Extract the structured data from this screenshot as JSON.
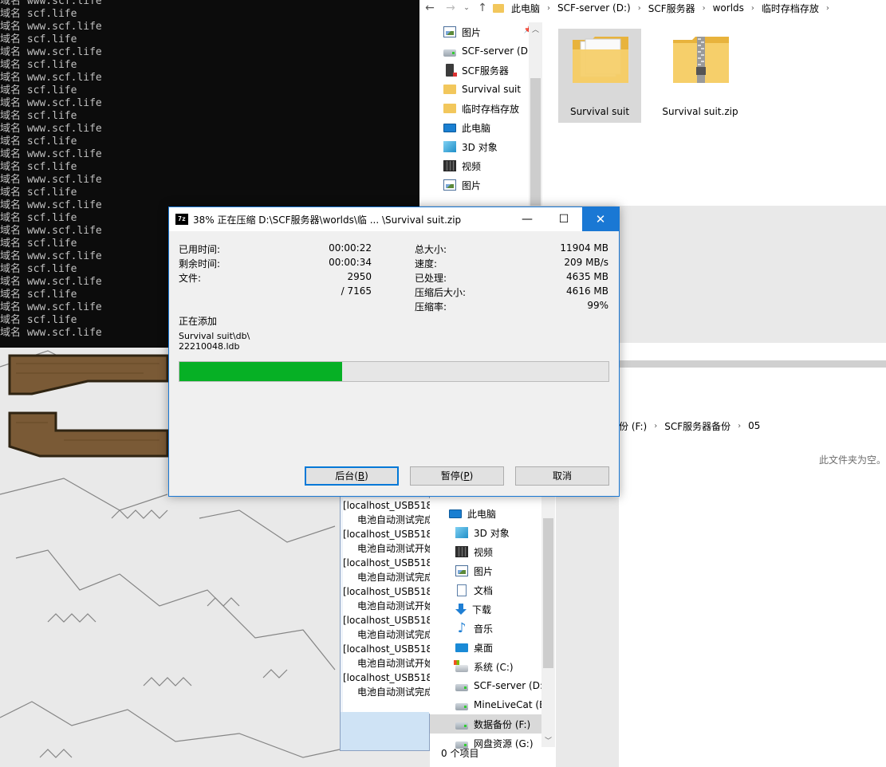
{
  "console": {
    "lines": [
      "域名 www.scf.life",
      "域名 scf.life",
      "域名 www.scf.life",
      "域名 scf.life",
      "域名 www.scf.life",
      "域名 scf.life",
      "域名 www.scf.life",
      "域名 scf.life",
      "域名 www.scf.life",
      "域名 scf.life",
      "域名 www.scf.life",
      "域名 scf.life",
      "域名 www.scf.life",
      "域名 scf.life",
      "域名 www.scf.life",
      "域名 scf.life",
      "域名 www.scf.life",
      "域名 scf.life",
      "域名 www.scf.life",
      "域名 scf.life",
      "域名 www.scf.life",
      "域名 scf.life",
      "域名 www.scf.life",
      "域名 scf.life",
      "域名 www.scf.life",
      "域名 scf.life",
      "域名 www.scf.life"
    ]
  },
  "explorer_top": {
    "breadcrumb": [
      "此电脑",
      "SCF-server (D:)",
      "SCF服务器",
      "worlds",
      "临时存档存放"
    ],
    "nav_items": [
      {
        "label": "图片",
        "icon": "pictures-icon",
        "pinned": true
      },
      {
        "label": "SCF-server (D:)",
        "icon": "drive-icon"
      },
      {
        "label": "SCF服务器",
        "icon": "server-icon"
      },
      {
        "label": "Survival suit",
        "icon": "folder-icon"
      },
      {
        "label": "临时存档存放",
        "icon": "folder-icon"
      },
      {
        "label": "此电脑",
        "icon": "computer-icon"
      },
      {
        "label": "3D 对象",
        "icon": "3d-objects-icon"
      },
      {
        "label": "视频",
        "icon": "video-icon"
      },
      {
        "label": "图片",
        "icon": "pictures-icon"
      }
    ],
    "files": [
      {
        "name": "Survival suit",
        "icon": "folder-icon",
        "selected": true
      },
      {
        "name": "Survival suit.zip",
        "icon": "zip-folder-icon",
        "selected": false
      }
    ]
  },
  "explorer_backup": {
    "breadcrumb": [
      "份 (F:)",
      "SCF服务器备份",
      "05"
    ],
    "empty_message": "此文件夹为空。",
    "status": "0 个项目",
    "nav_items": [
      {
        "label": "此电脑",
        "icon": "computer-icon"
      },
      {
        "label": "3D 对象",
        "icon": "3d-objects-icon"
      },
      {
        "label": "视频",
        "icon": "video-icon"
      },
      {
        "label": "图片",
        "icon": "pictures-icon"
      },
      {
        "label": "文档",
        "icon": "documents-icon"
      },
      {
        "label": "下载",
        "icon": "downloads-icon"
      },
      {
        "label": "音乐",
        "icon": "music-icon"
      },
      {
        "label": "桌面",
        "icon": "desktop-icon"
      },
      {
        "label": "系统 (C:)",
        "icon": "system-drive-icon"
      },
      {
        "label": "SCF-server (D:)",
        "icon": "drive-icon"
      },
      {
        "label": "MineLiveCat (E",
        "icon": "drive-icon"
      },
      {
        "label": "数据备份 (F:)",
        "icon": "drive-icon",
        "selected": true
      },
      {
        "label": "网盘资源 (G:)",
        "icon": "drive-icon"
      }
    ]
  },
  "log": {
    "lines": [
      {
        "text": "[localhost_USB518",
        "indent": false
      },
      {
        "text": "电池自动测试完成",
        "indent": true
      },
      {
        "text": "[localhost_USB518",
        "indent": false
      },
      {
        "text": "电池自动测试开始",
        "indent": true
      },
      {
        "text": "[localhost_USB518",
        "indent": false
      },
      {
        "text": "电池自动测试完成",
        "indent": true
      },
      {
        "text": "[localhost_USB518",
        "indent": false
      },
      {
        "text": "电池自动测试开始",
        "indent": true
      },
      {
        "text": "[localhost_USB518",
        "indent": false
      },
      {
        "text": "电池自动测试完成",
        "indent": true
      },
      {
        "text": "[localhost_USB518",
        "indent": false
      },
      {
        "text": "电池自动测试开始",
        "indent": true
      },
      {
        "text": "[localhost_USB518",
        "indent": false
      },
      {
        "text": "电池自动测试完成",
        "indent": true
      }
    ]
  },
  "dialog": {
    "logo": "7z",
    "title": "38% 正在压缩 D:\\SCF服务器\\worlds\\临 ... \\Survival suit.zip",
    "stats_left": [
      {
        "label": "已用时间:",
        "value": "00:00:22"
      },
      {
        "label": "剩余时间:",
        "value": "00:00:34"
      },
      {
        "label": "文件:",
        "value": "2950"
      },
      {
        "label": "",
        "value": "/ 7165"
      }
    ],
    "stats_right": [
      {
        "label": "总大小:",
        "value": "11904 MB"
      },
      {
        "label": "速度:",
        "value": "209 MB/s"
      },
      {
        "label": "已处理:",
        "value": "4635 MB"
      },
      {
        "label": "压缩后大小:",
        "value": "4616 MB"
      },
      {
        "label": "压缩率:",
        "value": "99%"
      }
    ],
    "adding_label": "正在添加",
    "current_file_line1": "Survival suit\\db\\",
    "current_file_line2": "22210048.ldb",
    "progress_percent": 38,
    "buttons": {
      "background": {
        "text": "后台(",
        "key": "B",
        "end": ")"
      },
      "pause": {
        "text": "暂停(",
        "key": "P",
        "end": ")"
      },
      "cancel": "取消"
    }
  },
  "colors": {
    "progress": "#06b025",
    "accent": "#1a78d4",
    "console_bg": "#0c0c0c"
  }
}
